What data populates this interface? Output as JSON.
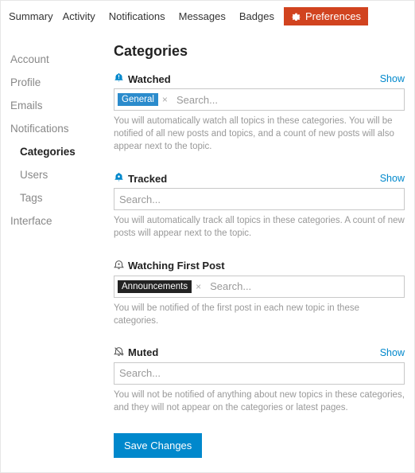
{
  "tabs": {
    "summary": "Summary",
    "activity": "Activity",
    "notifications": "Notifications",
    "messages": "Messages",
    "badges": "Badges",
    "preferences": "Preferences"
  },
  "sidebar": {
    "account": "Account",
    "profile": "Profile",
    "emails": "Emails",
    "notifications": "Notifications",
    "categories": "Categories",
    "users": "Users",
    "tags": "Tags",
    "interface": "Interface"
  },
  "main": {
    "heading": "Categories",
    "watched": {
      "label": "Watched",
      "show": "Show",
      "chip": "General",
      "placeholder": "Search...",
      "help": "You will automatically watch all topics in these categories. You will be notified of all new posts and topics, and a count of new posts will also appear next to the topic."
    },
    "tracked": {
      "label": "Tracked",
      "show": "Show",
      "placeholder": "Search...",
      "help": "You will automatically track all topics in these categories. A count of new posts will appear next to the topic."
    },
    "watching_first": {
      "label": "Watching First Post",
      "chip": "Announcements",
      "placeholder": "Search...",
      "help": "You will be notified of the first post in each new topic in these categories."
    },
    "muted": {
      "label": "Muted",
      "show": "Show",
      "placeholder": "Search...",
      "help": "You will not be notified of anything about new topics in these categories, and they will not appear on the categories or latest pages."
    },
    "save": "Save Changes"
  }
}
